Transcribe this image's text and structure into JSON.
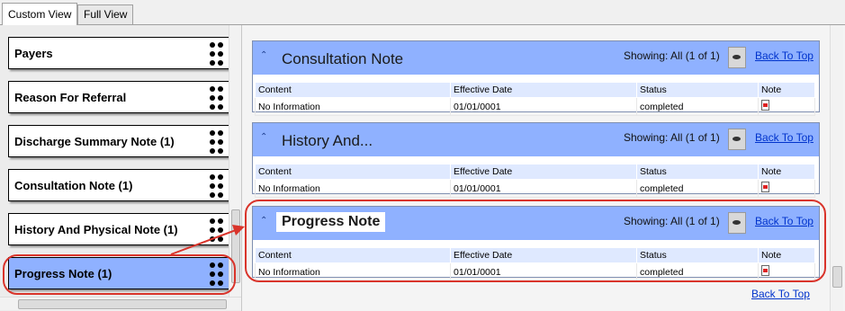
{
  "tabs": [
    "Custom View",
    "Full View"
  ],
  "sidebar": {
    "items": [
      {
        "label": "Payers"
      },
      {
        "label": "Reason For Referral"
      },
      {
        "label": "Discharge Summary Note (1)"
      },
      {
        "label": "Consultation Note (1)"
      },
      {
        "label": "History And Physical Note (1)"
      },
      {
        "label": "Progress Note (1)"
      }
    ]
  },
  "sections": [
    {
      "title": "Consultation Note",
      "showing": "Showing: All (1 of 1)",
      "back_to_top": "Back To Top",
      "columns": [
        "Content",
        "Effective Date",
        "Status",
        "Note"
      ],
      "rows": [
        [
          "No Information",
          "01/01/0001",
          "completed"
        ]
      ]
    },
    {
      "title": "History And...",
      "showing": "Showing: All (1 of 1)",
      "back_to_top": "Back To Top",
      "columns": [
        "Content",
        "Effective Date",
        "Status",
        "Note"
      ],
      "rows": [
        [
          "No Information",
          "01/01/0001",
          "completed"
        ]
      ]
    },
    {
      "title": "Progress Note",
      "showing": "Showing: All (1 of 1)",
      "back_to_top": "Back To Top",
      "columns": [
        "Content",
        "Effective Date",
        "Status",
        "Note"
      ],
      "rows": [
        [
          "No Information",
          "01/01/0001",
          "completed"
        ]
      ]
    }
  ],
  "footer": {
    "back_to_top": "Back To Top"
  },
  "colors": {
    "header_blue": "#8fb1ff",
    "annotation_red": "#d9342b",
    "link": "#0033cc"
  }
}
